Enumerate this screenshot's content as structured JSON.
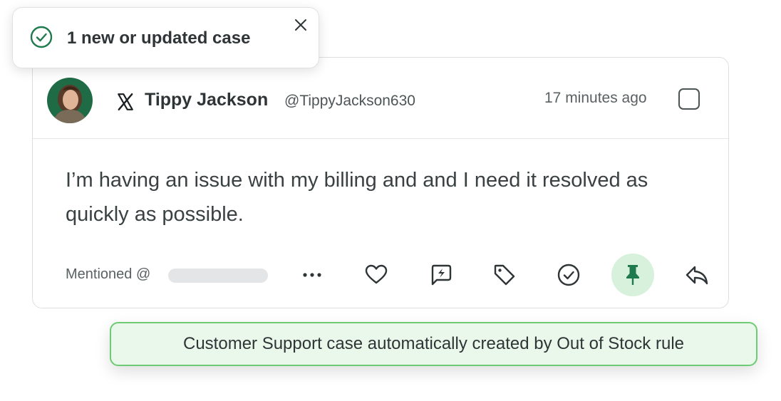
{
  "toast": {
    "text": "1 new or updated case",
    "icon": "check-circle-icon",
    "close_icon": "close-icon",
    "accent": "#1f7a4d"
  },
  "post": {
    "network_icon": "x-logo-icon",
    "author_name": "Tippy Jackson",
    "author_handle": "@TippyJackson630",
    "timestamp": "17 minutes ago",
    "message": "I’m having an issue with my billing and and I need it resolved as quickly as possible.",
    "mention_label": "Mentioned @"
  },
  "actions": [
    {
      "name": "more-options-icon"
    },
    {
      "name": "heart-icon"
    },
    {
      "name": "quick-reply-icon"
    },
    {
      "name": "tag-icon"
    },
    {
      "name": "check-circle-icon"
    },
    {
      "name": "pin-icon",
      "active": true,
      "active_color": "#1f7a4d"
    },
    {
      "name": "reply-icon"
    }
  ],
  "rule_banner": {
    "text": "Customer Support case automatically created by Out of Stock rule",
    "background": "#e9f8ea",
    "border": "#6ccb73"
  }
}
